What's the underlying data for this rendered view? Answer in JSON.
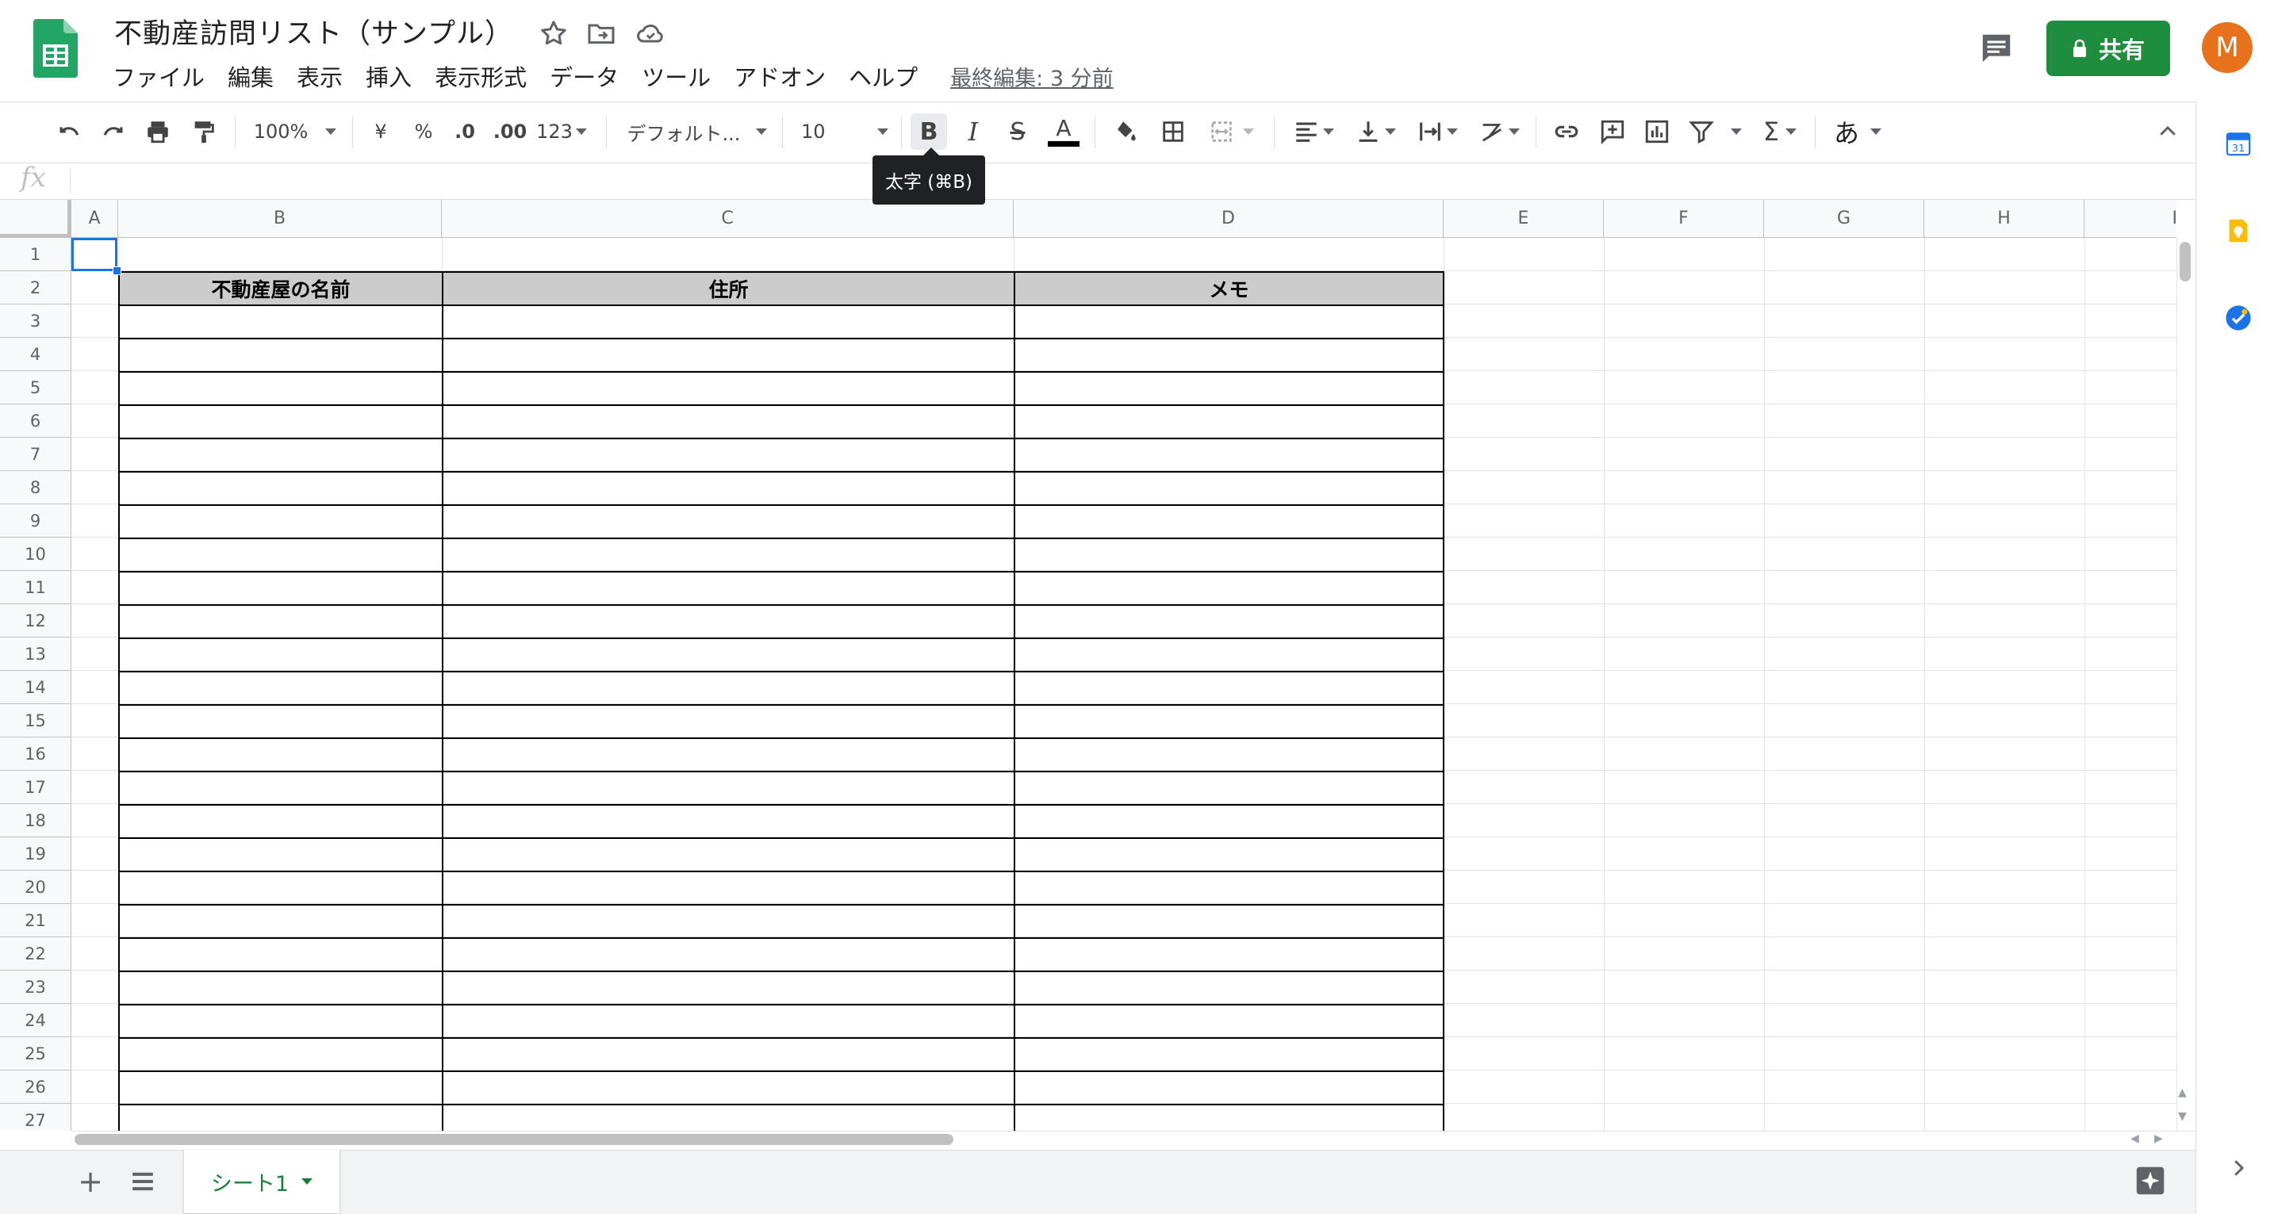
{
  "app": {
    "title": "不動産訪問リスト（サンプル）",
    "menu": [
      "ファイル",
      "編集",
      "表示",
      "挿入",
      "表示形式",
      "データ",
      "ツール",
      "アドオン",
      "ヘルプ"
    ],
    "last_edit": "最終編集: 3 分前",
    "share_label": "共有",
    "avatar_initial": "M"
  },
  "toolbar": {
    "zoom": "100%",
    "currency": "¥",
    "percent": "%",
    "decrease_decimal": ".0",
    "increase_decimal": ".00",
    "more_formats": "123",
    "font": "デフォルト...",
    "font_size": "10",
    "input_tools": "あ",
    "tooltip": "太字 (⌘B)"
  },
  "formula_bar": {
    "fx": "fx",
    "value": ""
  },
  "grid": {
    "columns": [
      "A",
      "B",
      "C",
      "D",
      "E",
      "F",
      "G",
      "H",
      "I"
    ],
    "rows": [
      "1",
      "2",
      "3",
      "4",
      "5",
      "6",
      "7",
      "8",
      "9",
      "10",
      "11",
      "12",
      "13",
      "14",
      "15",
      "16",
      "17",
      "18",
      "19",
      "20",
      "21",
      "22",
      "23",
      "24",
      "25",
      "26",
      "27"
    ],
    "selected_cell": "A1",
    "table_headers": [
      "不動産屋の名前",
      "住所",
      "メモ"
    ]
  },
  "sheets": {
    "tabs": [
      "シート1"
    ],
    "active": "シート1"
  },
  "colors": {
    "accent_green": "#1e8e3e",
    "sheet_tab_green": "#188038",
    "selection_blue": "#1a73e8",
    "header_fill": "#cccccc",
    "avatar": "#e8711c"
  }
}
